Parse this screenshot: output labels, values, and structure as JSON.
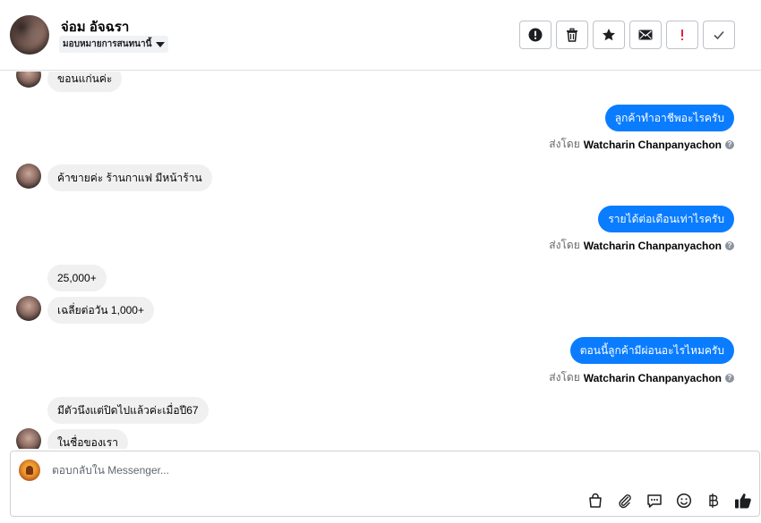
{
  "header": {
    "contact_name": "จ่อม อัจฉรา",
    "assign_label": "มอบหมายการสนทนานี้",
    "toolbar": [
      {
        "name": "flag-spam-button",
        "icon": "exclamation-circle-icon"
      },
      {
        "name": "delete-button",
        "icon": "trash-icon"
      },
      {
        "name": "star-button",
        "icon": "star-icon"
      },
      {
        "name": "mark-unread-button",
        "icon": "envelope-icon"
      },
      {
        "name": "mark-important-button",
        "icon": "red-exclamation-icon"
      },
      {
        "name": "mark-done-button",
        "icon": "checkmark-icon"
      }
    ]
  },
  "messages": [
    {
      "dir": "in",
      "text": "ขอนแก่นค่ะ"
    },
    {
      "dir": "out",
      "text": "ลูกค้าทำอาชีพอะไรครับ"
    },
    {
      "dir": "in",
      "text": "ค้าขายค่ะ ร้านกาแฟ มีหน้าร้าน"
    },
    {
      "dir": "out",
      "text": "รายได้ต่อเดือนเท่าไรครับ"
    },
    {
      "dir": "in",
      "text": "25,000+"
    },
    {
      "dir": "in",
      "text": "เฉลี่ยต่อวัน 1,000+"
    },
    {
      "dir": "out",
      "text": "ตอนนี้ลูกค้ามีผ่อนอะไรไหมครับ"
    },
    {
      "dir": "in",
      "text": "มีตัวนึงแต่ปิดไปแล้วค่ะเมื่อปี67"
    },
    {
      "dir": "in",
      "text": "ในชื่อของเรา"
    }
  ],
  "sent_by": {
    "prefix": "ส่งโดย",
    "agent": "Watcharin Chanpanyachon",
    "help": "?"
  },
  "composer": {
    "placeholder": "ตอบกลับใน Messenger...",
    "icons": [
      "shopping-bag-icon",
      "paperclip-icon",
      "saved-reply-icon",
      "emoji-icon",
      "baht-icon",
      "thumbs-up-icon"
    ]
  },
  "colors": {
    "outgoing_bubble": "#0a7cff",
    "incoming_bubble": "#f0f0f0",
    "important": "#e41e3f",
    "thumbs_up": "#1c1e21"
  }
}
